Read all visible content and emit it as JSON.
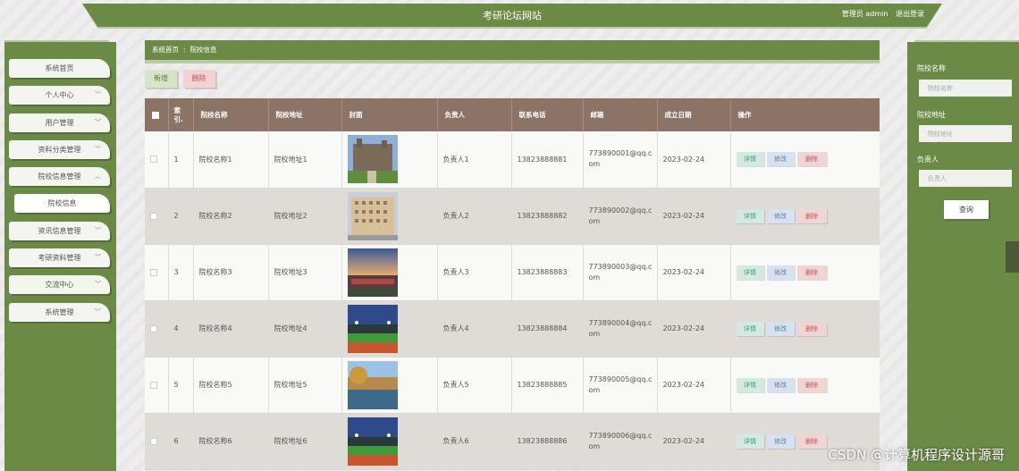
{
  "header": {
    "site_title": "考研论坛网站",
    "user_label": "管理员 admin",
    "logout_label": "退出登录"
  },
  "sidebar": {
    "items": [
      {
        "label": "系统首页",
        "has_chevron": false
      },
      {
        "label": "个人中心",
        "has_chevron": true
      },
      {
        "label": "用户管理",
        "has_chevron": true
      },
      {
        "label": "资料分类管理",
        "has_chevron": true
      },
      {
        "label": "院校信息管理",
        "has_chevron": true
      },
      {
        "label": "院校信息",
        "has_chevron": false,
        "active": true
      },
      {
        "label": "资讯信息管理",
        "has_chevron": true
      },
      {
        "label": "考研资料管理",
        "has_chevron": true
      },
      {
        "label": "交流中心",
        "has_chevron": true
      },
      {
        "label": "系统管理",
        "has_chevron": true
      }
    ]
  },
  "breadcrumb": {
    "home": "系统首页",
    "separator": ":",
    "current": "院校信息"
  },
  "toolbar": {
    "add_label": "新增",
    "delete_label": "删除"
  },
  "table": {
    "headers": [
      "索引",
      "院校名称",
      "院校地址",
      "封面",
      "负责人",
      "联系电话",
      "邮箱",
      "成立日期",
      "操作"
    ],
    "index_header_lines": [
      "索",
      "引."
    ],
    "ops": {
      "detail": "详情",
      "edit": "修改",
      "delete": "删除"
    },
    "rows": [
      {
        "index": "1",
        "name": "院校名称1",
        "address": "院校地址1",
        "cover": "campus-building",
        "person": "负责人1",
        "phone": "13823888881",
        "email": "773890001@qq.com",
        "date": "2023-02-24"
      },
      {
        "index": "2",
        "name": "院校名称2",
        "address": "院校地址2",
        "cover": "tall-building",
        "person": "负责人2",
        "phone": "13823888882",
        "email": "773890002@qq.com",
        "date": "2023-02-24"
      },
      {
        "index": "3",
        "name": "院校名称3",
        "address": "院校地址3",
        "cover": "sunset-campus",
        "person": "负责人3",
        "phone": "13823888883",
        "email": "773890003@qq.com",
        "date": "2023-02-24"
      },
      {
        "index": "4",
        "name": "院校名称4",
        "address": "院校地址4",
        "cover": "stadium-night",
        "person": "负责人4",
        "phone": "13823888884",
        "email": "773890004@qq.com",
        "date": "2023-02-24"
      },
      {
        "index": "5",
        "name": "院校名称5",
        "address": "院校地址5",
        "cover": "lake-campus",
        "person": "负责人5",
        "phone": "13823888885",
        "email": "773890005@qq.com",
        "date": "2023-02-24"
      },
      {
        "index": "6",
        "name": "院校名称6",
        "address": "院校地址6",
        "cover": "stadium-night",
        "person": "负责人6",
        "phone": "13823888886",
        "email": "773890006@qq.com",
        "date": "2023-02-24"
      }
    ]
  },
  "search": {
    "name_label": "院校名称",
    "name_placeholder": "院校名称",
    "address_label": "院校地址",
    "address_placeholder": "院校地址",
    "person_label": "负责人",
    "person_placeholder": "负责人",
    "button_label": "查询"
  },
  "watermark": "CSDN @计算机程序设计源哥",
  "colors": {
    "accent": "#6a8a46",
    "table_header": "#8b7466"
  }
}
